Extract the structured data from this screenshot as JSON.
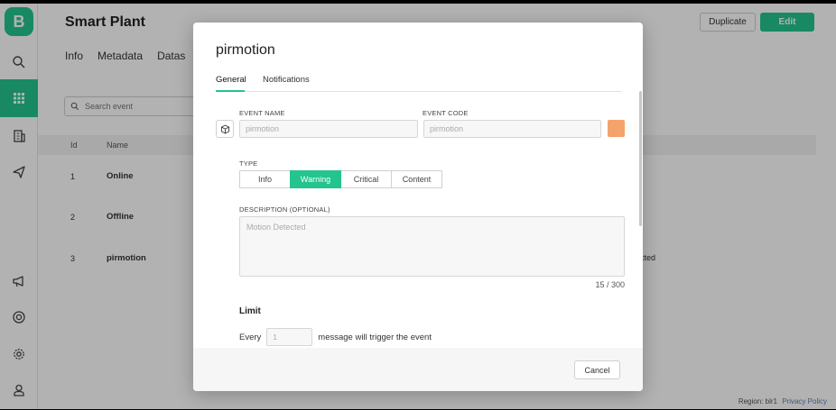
{
  "app": {
    "logo_letter": "B",
    "title": "Smart Plant",
    "duplicate_label": "Duplicate",
    "edit_label": "Edit",
    "brand_color": "#23c48e"
  },
  "sidebar": {
    "items": [
      {
        "icon": "search-icon"
      },
      {
        "icon": "grid-icon",
        "active": true
      },
      {
        "icon": "building-icon"
      },
      {
        "icon": "send-icon"
      },
      {
        "icon": "megaphone-icon"
      },
      {
        "icon": "lifebuoy-icon"
      },
      {
        "icon": "gear-icon"
      },
      {
        "icon": "user-icon"
      }
    ]
  },
  "page_tabs": [
    "Info",
    "Metadata",
    "Datas"
  ],
  "search": {
    "placeholder": "Search event"
  },
  "table": {
    "headers": {
      "id": "Id",
      "name": "Name"
    },
    "rows": [
      {
        "id": "1",
        "name": "Online",
        "desc": ""
      },
      {
        "id": "2",
        "name": "Offline",
        "desc": ""
      },
      {
        "id": "3",
        "name": "pirmotion",
        "desc": "cted"
      }
    ]
  },
  "footer": {
    "region": "Region: blr1",
    "privacy": "Privacy Policy"
  },
  "modal": {
    "title": "pirmotion",
    "tabs": [
      "General",
      "Notifications"
    ],
    "event_name_label": "EVENT NAME",
    "event_name_placeholder": "pirmotion",
    "event_code_label": "EVENT CODE",
    "event_code_placeholder": "pirmotion",
    "event_color": "#f4a36c",
    "type_label": "TYPE",
    "type_options": [
      "Info",
      "Warning",
      "Critical",
      "Content"
    ],
    "type_selected": "Warning",
    "description_label": "DESCRIPTION (OPTIONAL)",
    "description_placeholder": "Motion Detected",
    "counter": "15 / 300",
    "limit_title": "Limit",
    "limit_prefix": "Every",
    "limit_value": "1",
    "limit_suffix": "message will trigger the event",
    "cancel_label": "Cancel"
  }
}
